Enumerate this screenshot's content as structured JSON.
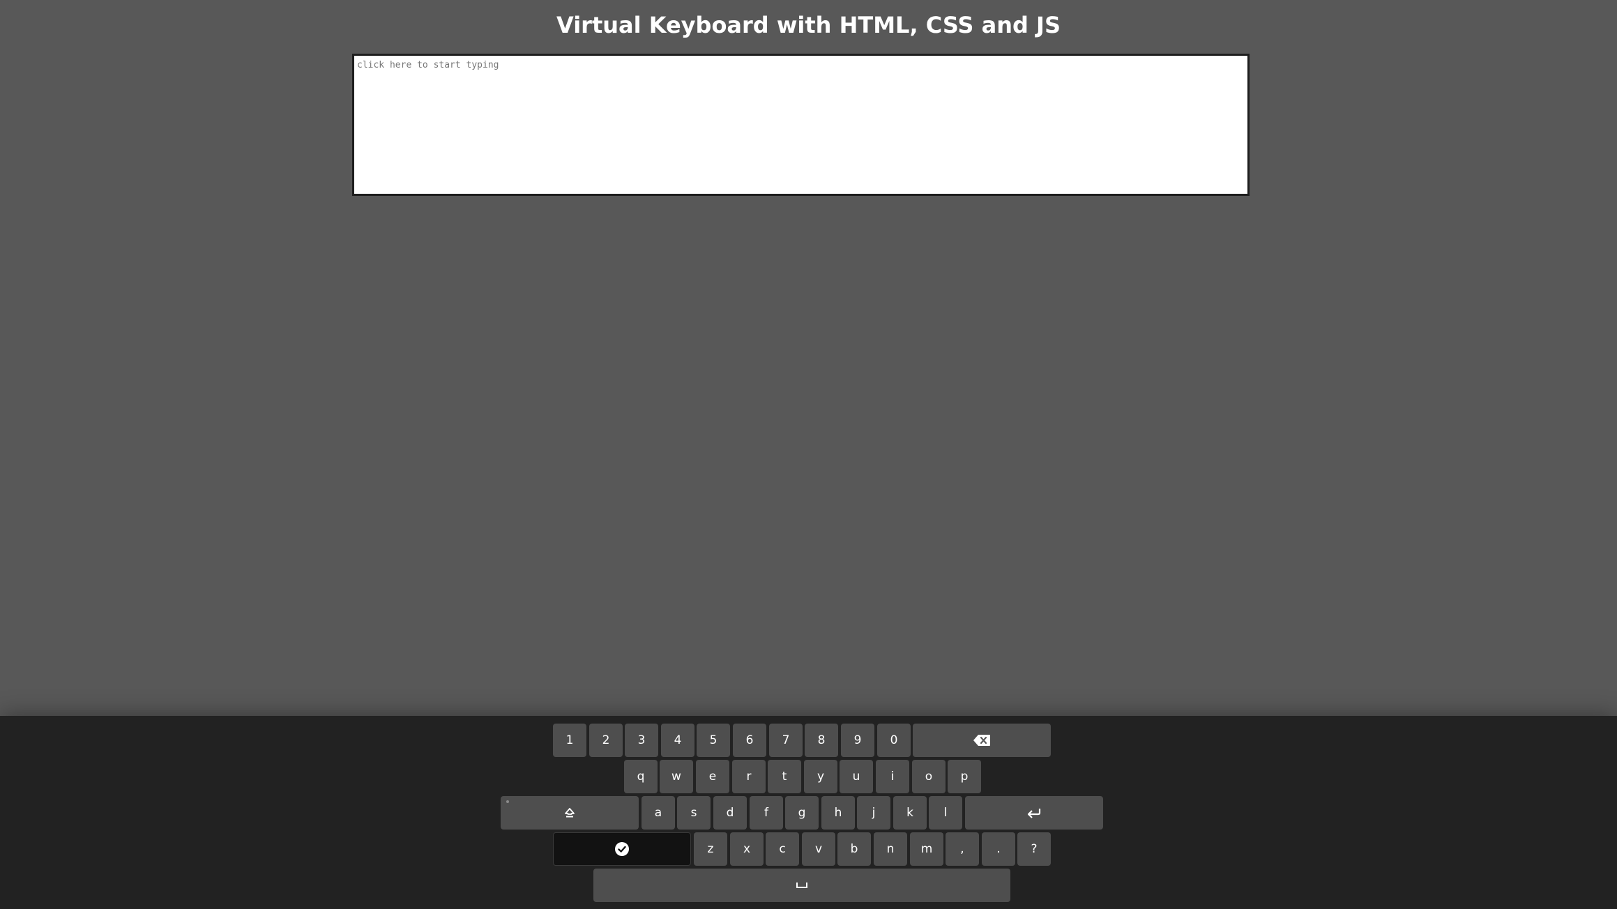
{
  "header": {
    "title": "Virtual Keyboard with HTML, CSS and JS"
  },
  "textarea": {
    "placeholder": "click here to start typing",
    "value": ""
  },
  "keyboard": {
    "row1": [
      "1",
      "2",
      "3",
      "4",
      "5",
      "6",
      "7",
      "8",
      "9",
      "0"
    ],
    "backspace_icon": "backspace-icon",
    "row2": [
      "q",
      "w",
      "e",
      "r",
      "t",
      "y",
      "u",
      "i",
      "o",
      "p"
    ],
    "caps_icon": "caps-lock-icon",
    "row3": [
      "a",
      "s",
      "d",
      "f",
      "g",
      "h",
      "j",
      "k",
      "l"
    ],
    "enter_icon": "enter-icon",
    "done_icon": "check-circle-icon",
    "row4": [
      "z",
      "x",
      "c",
      "v",
      "b",
      "n",
      "m",
      ",",
      ".",
      "?"
    ],
    "space_icon": "space-bar-icon"
  },
  "colors": {
    "page_background": "#585858",
    "keyboard_background": "#222222",
    "key_background": "#5a5a5a",
    "done_key_background": "#141414"
  }
}
